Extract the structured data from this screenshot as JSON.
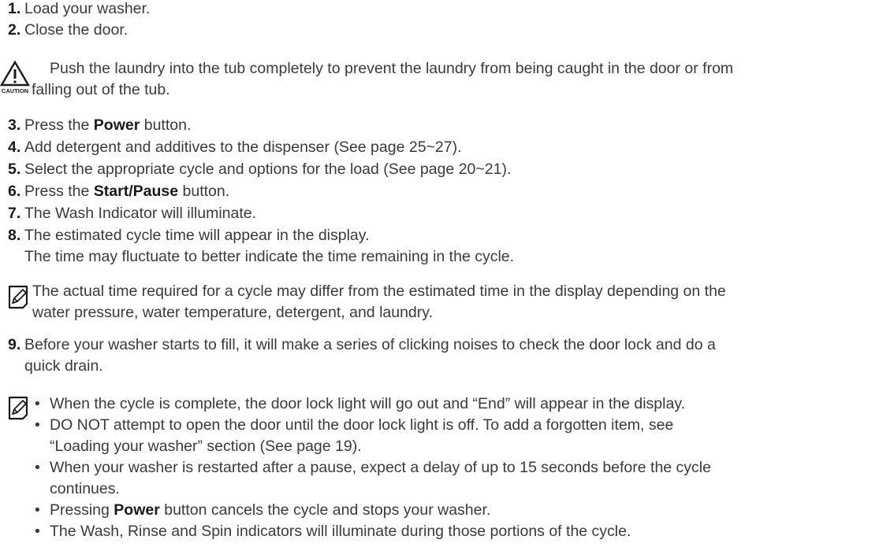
{
  "steps_top": [
    {
      "num": "1.",
      "text": "Load your washer."
    },
    {
      "num": "2.",
      "text": "Close the door."
    }
  ],
  "caution": {
    "icon_label": "CAUTION",
    "line1": "Push the laundry into the tub completely to prevent the laundry from being caught in the door or from",
    "line2": "falling out of the tub."
  },
  "steps_mid": {
    "s3": {
      "num": "3.",
      "pre": "Press the ",
      "bold": "Power",
      "post": " button."
    },
    "s4": {
      "num": "4.",
      "text": "Add detergent and additives to the dispenser (See page 25~27)."
    },
    "s5": {
      "num": "5.",
      "text": "Select the appropriate cycle and options for the load (See page 20~21)."
    },
    "s6": {
      "num": "6.",
      "pre": "Press the ",
      "bold": "Start/Pause",
      "post": " button."
    },
    "s7": {
      "num": "7.",
      "text": "The Wash Indicator will illuminate."
    },
    "s8": {
      "num": "8.",
      "line1": "The estimated cycle time will appear in the display.",
      "line2": "The time may fluctuate to better indicate the time remaining in the cycle."
    }
  },
  "note1": {
    "line1": "The actual time required for a cycle may differ from the estimated time in the display depending on the",
    "line2": "water pressure, water temperature, detergent, and laundry."
  },
  "step9": {
    "num": "9.",
    "line1": "Before your washer starts to fill, it will make a series of clicking noises to check the door lock and do a",
    "line2": "quick drain."
  },
  "note2": {
    "b1": "When the cycle is complete, the door lock light will go out and “End” will appear in the display.",
    "b2_line1": "DO NOT attempt to open the door until the door lock light is off. To add a forgotten item, see",
    "b2_line2": "“Loading your washer” section (See page 19).",
    "b3_line1": "When your washer is restarted after a pause, expect a delay of up to 15 seconds before the cycle",
    "b3_line2": "continues.",
    "b4_pre": "Pressing ",
    "b4_bold": "Power",
    "b4_post": " button cancels the cycle and stops your washer.",
    "b5": "The Wash, Rinse and Spin indicators will illuminate during those portions of the cycle."
  }
}
